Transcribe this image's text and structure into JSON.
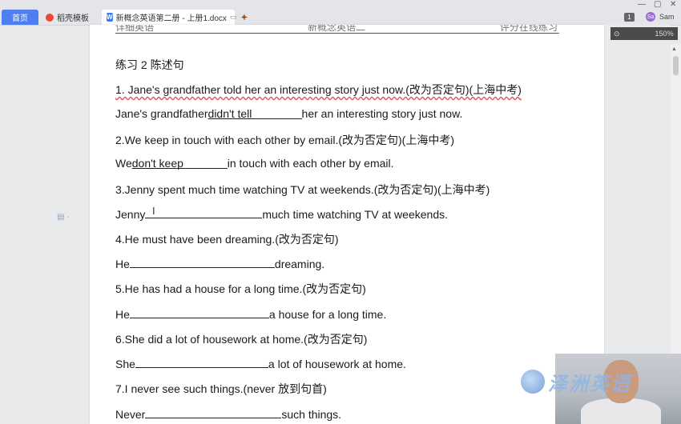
{
  "tabs": {
    "home": "首页",
    "templates": "稻壳模板",
    "document": "新概念英语第二册 - 上册1.docx",
    "add": "+"
  },
  "window": {
    "minimize": "—",
    "restore": "▢",
    "close": "✕",
    "badge": "1",
    "user_initial": "Sa",
    "user_name": "Sam",
    "zoom": "150%"
  },
  "header_strip": {
    "left": "详细英语",
    "middle": "新概念英语二",
    "right": "评分在线练习"
  },
  "exercise": {
    "title": "练习  2 陈述句",
    "items": [
      {
        "q": "1.   Jane's grandfather told her an interesting story just now.(改为否定句)(上海中考)",
        "a_pre": "Jane's grandfather",
        "a_fill": " didn't tell",
        "a_post": "her an interesting story just now."
      },
      {
        "q": "2.We keep in touch with each other by email.(改为否定句)(上海中考)",
        "a_pre": "We",
        "a_fill": " don't keep",
        "a_post": "in touch with each other by email."
      },
      {
        "q": "3.Jenny spent much time watching TV at weekends.(改为否定句)(上海中考)",
        "a_pre": "Jenny",
        "a_fill": "",
        "a_post": "much time watching TV at weekends."
      },
      {
        "q": "4.He must have been dreaming.(改为否定句)",
        "a_pre": "He",
        "a_fill": "",
        "a_post": "dreaming."
      },
      {
        "q": "5.He has had a house for a long time.(改为否定句)",
        "a_pre": "He",
        "a_fill": "",
        "a_post": "a house for a long time."
      },
      {
        "q": "6.She did a lot of housework at home.(改为否定句)",
        "a_pre": "She",
        "a_fill": "",
        "a_post": "a lot of housework at home."
      },
      {
        "q": "7.I never see such things.(never  放到句首)",
        "a_pre": "Never",
        "a_fill": "",
        "a_post": "such things."
      }
    ]
  },
  "overlay": {
    "brand": "泽洲英语"
  }
}
